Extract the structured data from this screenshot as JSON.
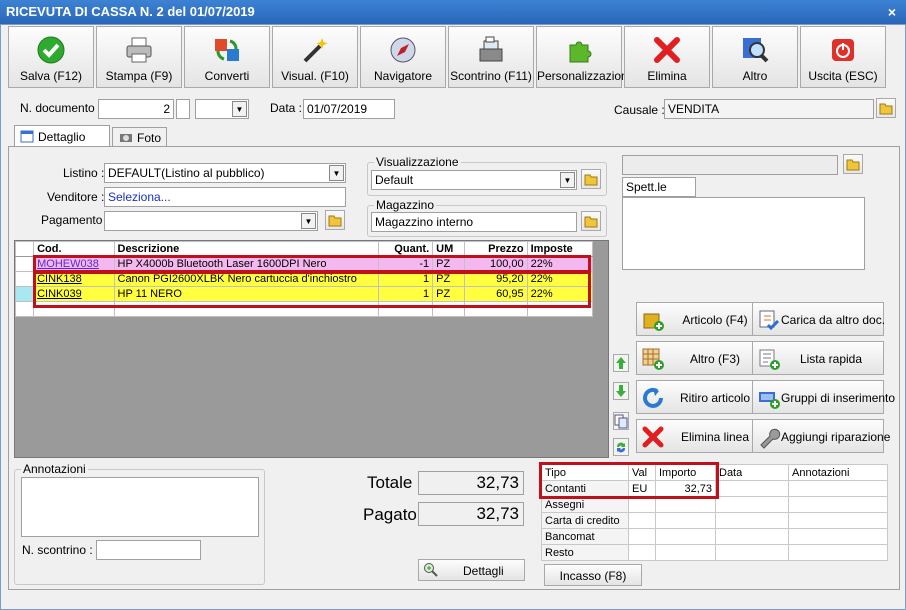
{
  "window": {
    "title": "RICEVUTA DI CASSA N. 2 del 01/07/2019",
    "close": "×"
  },
  "toolbar": [
    {
      "label": "Salva (F12)",
      "icon": "check-icon"
    },
    {
      "label": "Stampa (F9)",
      "icon": "printer-icon"
    },
    {
      "label": "Converti",
      "icon": "convert-icon"
    },
    {
      "label": "Visual. (F10)",
      "icon": "magic-wand-icon"
    },
    {
      "label": "Navigatore",
      "icon": "compass-icon"
    },
    {
      "label": "Scontrino (F11)",
      "icon": "cash-register-icon"
    },
    {
      "label": "Personalizzazioni",
      "icon": "puzzle-icon"
    },
    {
      "label": "Elimina",
      "icon": "delete-x-icon"
    },
    {
      "label": "Altro",
      "icon": "magnifier-icon"
    },
    {
      "label": "Uscita (ESC)",
      "icon": "power-icon"
    }
  ],
  "header": {
    "doc_label": "N. documento :",
    "doc_number": "2",
    "doc_suffix": "",
    "date_label": "Data :",
    "date_value": "01/07/2019",
    "causale_label": "Causale :",
    "causale_value": "VENDITA"
  },
  "tabs": [
    {
      "label": "Dettaglio (F5)",
      "icon": "calendar-icon",
      "active": true
    },
    {
      "label": "Foto",
      "icon": "camera-icon",
      "active": false
    }
  ],
  "form": {
    "listino_label": "Listino :",
    "listino_value": "DEFAULT(Listino al pubblico)",
    "venditore_label": "Venditore :",
    "venditore_value": "Seleziona...",
    "pagamento_label": "Pagamento :",
    "pagamento_value": "",
    "visualizzazione_label": "Visualizzazione",
    "visualizzazione_value": "Default",
    "magazzino_label": "Magazzino",
    "magazzino_value": "Magazzino interno",
    "customer_top": "",
    "customer_name": "Spett.le",
    "customer_address": ""
  },
  "grid": {
    "columns": [
      "Cod.",
      "Descrizione",
      "Quant.",
      "UM",
      "Prezzo",
      "Imposte"
    ],
    "rows": [
      {
        "code": "MOHEW038",
        "desc": "HP X4000b Bluetooth Laser 1600DPI Nero",
        "qty": "-1",
        "um": "PZ",
        "price": "100,00",
        "tax": "22%",
        "bg": "#f4b8f0",
        "code_color": "#5a2ad0"
      },
      {
        "code": "CINK138",
        "desc": "Canon PGI2600XLBK Nero cartuccia d'inchiostro",
        "qty": "1",
        "um": "PZ",
        "price": "95,20",
        "tax": "22%",
        "bg": "#ffff40",
        "code_color": "#000000"
      },
      {
        "code": "CINK039",
        "desc": "HP 11 NERO",
        "qty": "1",
        "um": "PZ",
        "price": "60,95",
        "tax": "22%",
        "bg": "#ffff40",
        "code_color": "#000000"
      }
    ]
  },
  "actions": [
    {
      "label": "Articolo (F4)",
      "icon": "box-add-icon"
    },
    {
      "label": "Carica da altro doc.",
      "icon": "document-check-icon"
    },
    {
      "label": "Altro (F3)",
      "icon": "grid-add-icon"
    },
    {
      "label": "Lista rapida",
      "icon": "list-add-icon"
    },
    {
      "label": "Ritiro articolo",
      "icon": "return-arrow-icon"
    },
    {
      "label": "Gruppi di inserimento",
      "icon": "cash-add-icon"
    },
    {
      "label": "Elimina linea",
      "icon": "delete-x-icon"
    },
    {
      "label": "Aggiungi riparazione",
      "icon": "wrench-icon"
    }
  ],
  "notes": {
    "label": "Annotazioni",
    "value": "",
    "scontrino_label": "N. scontrino :",
    "scontrino_value": ""
  },
  "totals": {
    "totale_label": "Totale",
    "totale_value": "32,73",
    "pagato_label": "Pagato",
    "pagato_value": "32,73",
    "dettagli_label": "Dettagli"
  },
  "payments": {
    "columns": [
      "Tipo",
      "Val",
      "Importo",
      "Data",
      "Annotazioni"
    ],
    "rows": [
      {
        "tipo": "Contanti",
        "val": "EU",
        "importo": "32,73",
        "data": "",
        "note": ""
      },
      {
        "tipo": "Assegni",
        "val": "",
        "importo": "",
        "data": "",
        "note": ""
      },
      {
        "tipo": "Carta di credito",
        "val": "",
        "importo": "",
        "data": "",
        "note": ""
      },
      {
        "tipo": "Bancomat",
        "val": "",
        "importo": "",
        "data": "",
        "note": ""
      },
      {
        "tipo": "Resto",
        "val": "",
        "importo": "",
        "data": "",
        "note": ""
      }
    ],
    "incasso_label": "Incasso (F8)"
  },
  "colors": {
    "highlight_border": "#c0101a",
    "title_bar": "#2f6fc4",
    "return_row": "#f4b8f0",
    "sale_row": "#ffff40"
  }
}
